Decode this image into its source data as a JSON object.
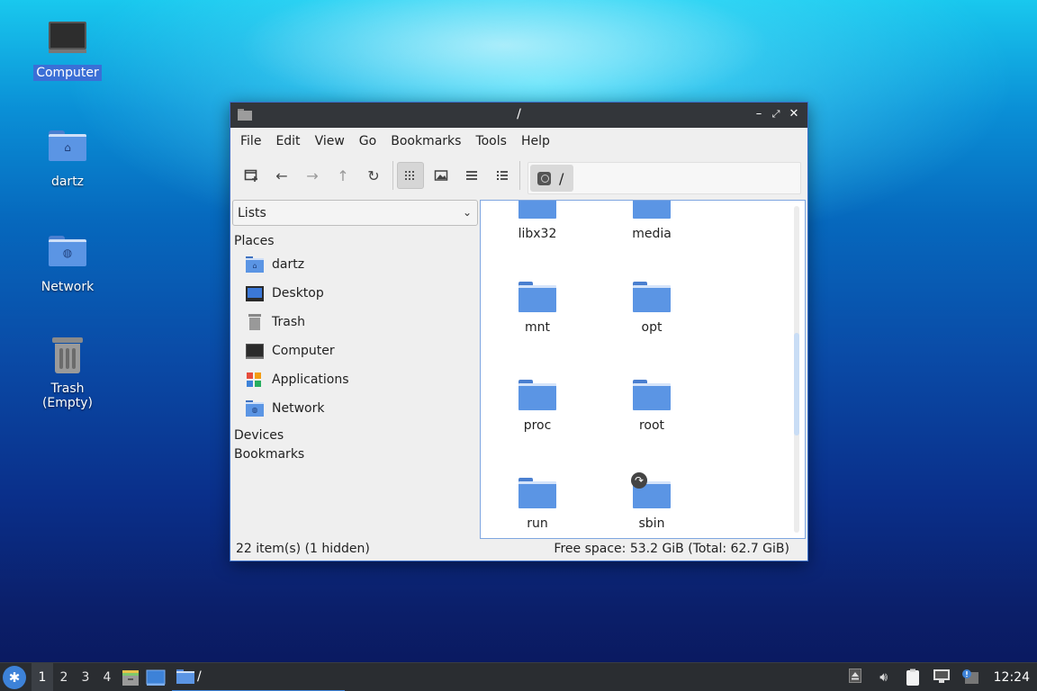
{
  "desktop": {
    "icons": [
      {
        "label": "Computer"
      },
      {
        "label": "dartz"
      },
      {
        "label": "Network"
      },
      {
        "label": "Trash (Empty)"
      }
    ]
  },
  "window": {
    "title": "/",
    "menu": [
      "File",
      "Edit",
      "View",
      "Go",
      "Bookmarks",
      "Tools",
      "Help"
    ],
    "path": "/",
    "side_combo": "Lists",
    "sections": {
      "places": "Places",
      "devices": "Devices",
      "bookmarks": "Bookmarks"
    },
    "places": [
      {
        "label": "dartz",
        "icon": "home-folder-icon"
      },
      {
        "label": "Desktop",
        "icon": "desktop-icon"
      },
      {
        "label": "Trash",
        "icon": "trash-icon"
      },
      {
        "label": "Computer",
        "icon": "computer-icon"
      },
      {
        "label": "Applications",
        "icon": "applications-icon"
      },
      {
        "label": "Network",
        "icon": "network-folder-icon"
      }
    ],
    "items": [
      {
        "name": "libx32"
      },
      {
        "name": "media"
      },
      {
        "name": "mnt"
      },
      {
        "name": "opt"
      },
      {
        "name": "proc"
      },
      {
        "name": "root"
      },
      {
        "name": "run"
      },
      {
        "name": "sbin",
        "symlink": true
      }
    ],
    "status_left": "22 item(s) (1 hidden)",
    "status_right": "Free space: 53.2 GiB (Total: 62.7 GiB)"
  },
  "taskbar": {
    "workspaces": [
      "1",
      "2",
      "3",
      "4"
    ],
    "task_title": "/",
    "clock": "12:24"
  },
  "colors": {
    "accent": "#3d82d8",
    "folder": "#5b95e4",
    "titlebar": "#33363a",
    "taskbar": "#2a2d31"
  }
}
